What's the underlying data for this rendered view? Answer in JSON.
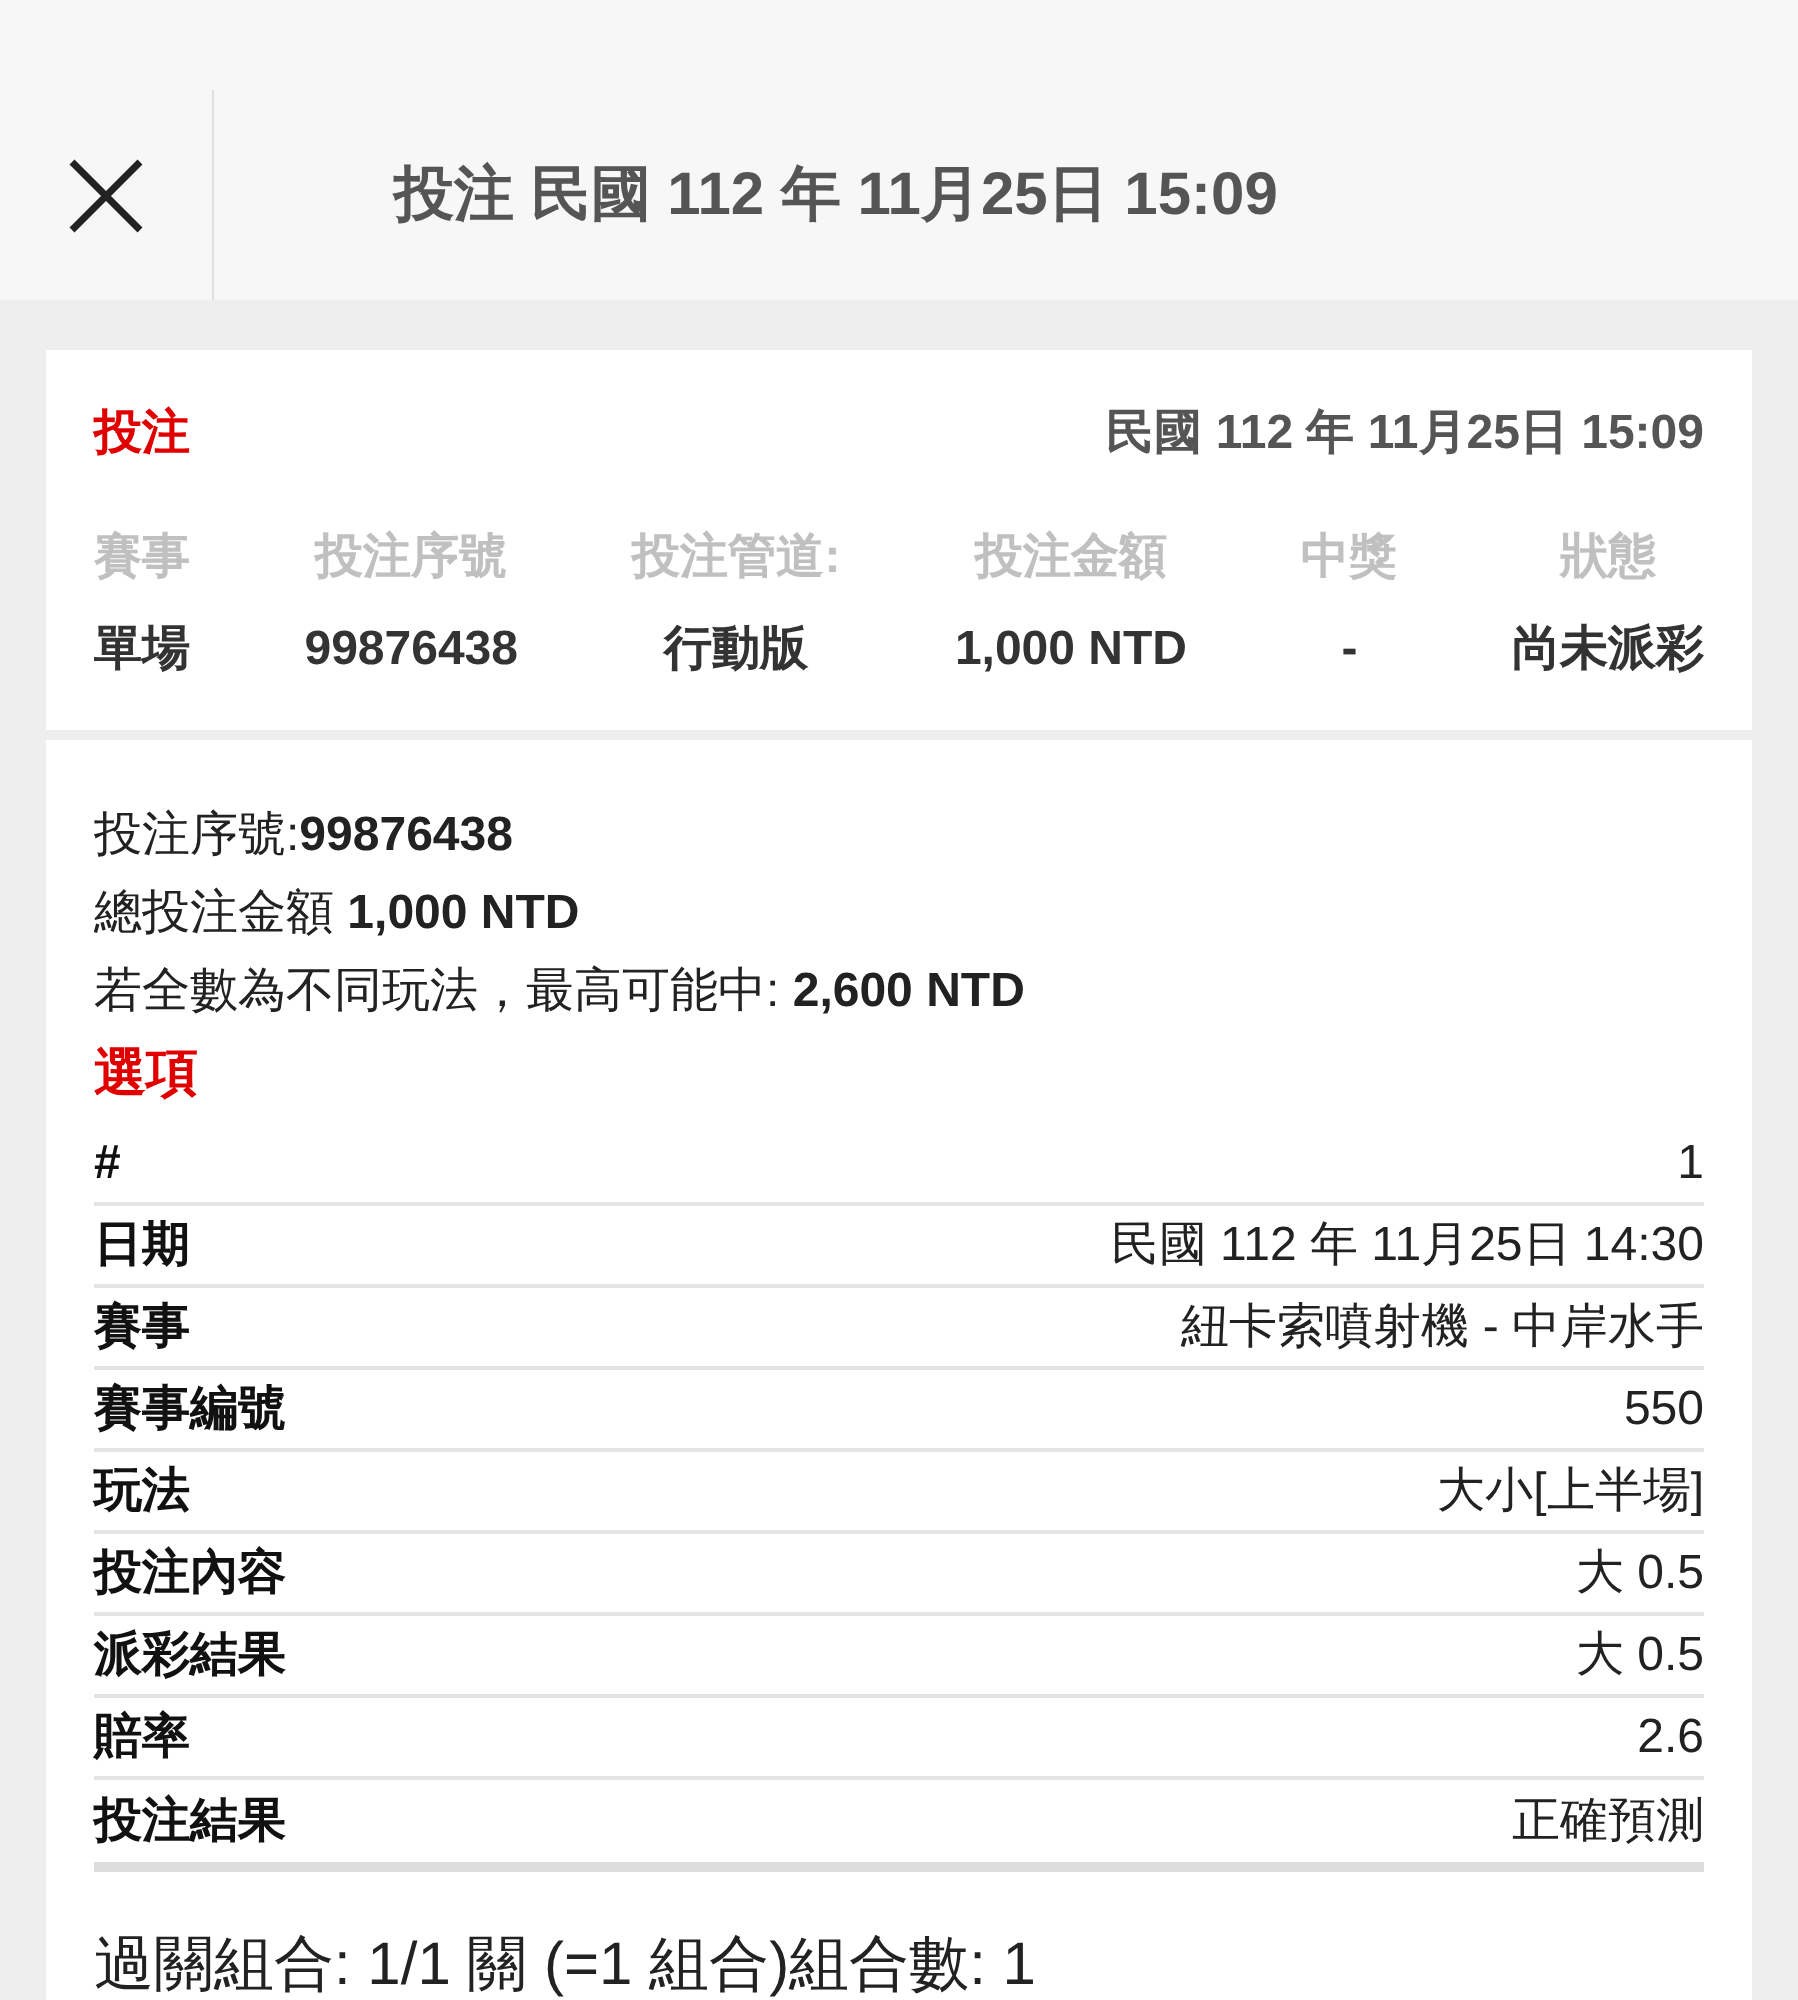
{
  "header": {
    "title": "投注 民國 112 年 11月25日 15:09"
  },
  "summary": {
    "heading": "投注",
    "datetime": "民國 112 年 11月25日 15:09",
    "columns": [
      {
        "label": "賽事",
        "value": "單場"
      },
      {
        "label": "投注序號",
        "value": "99876438"
      },
      {
        "label": "投注管道:",
        "value": "行動版"
      },
      {
        "label": "投注金額",
        "value": "1,000 NTD"
      },
      {
        "label": "中獎",
        "value": "-"
      },
      {
        "label": "狀態",
        "value": "尚未派彩"
      }
    ]
  },
  "details": {
    "lines": [
      "投注序號:**99876438**",
      "總投注金額 **1,000 NTD**",
      "若全數為不同玩法，最高可能中: **2,600 NTD**"
    ]
  },
  "options": {
    "heading": "選項",
    "rows": [
      {
        "label": "#",
        "value": "1"
      },
      {
        "label": "日期",
        "value": "民國 112 年 11月25日 14:30"
      },
      {
        "label": "賽事",
        "value": "紐卡索噴射機 - 中岸水手"
      },
      {
        "label": "賽事編號",
        "value": "550"
      },
      {
        "label": "玩法",
        "value": "大小[上半場]"
      },
      {
        "label": "投注內容",
        "value": "大 0.5"
      },
      {
        "label": "派彩結果",
        "value": "大 0.5"
      },
      {
        "label": "賠率",
        "value": "2.6"
      },
      {
        "label": "投注結果",
        "value": "正確預測"
      }
    ]
  },
  "footer": {
    "text": "過關組合: 1/1 關 (=1 組合)組合數: 1"
  }
}
